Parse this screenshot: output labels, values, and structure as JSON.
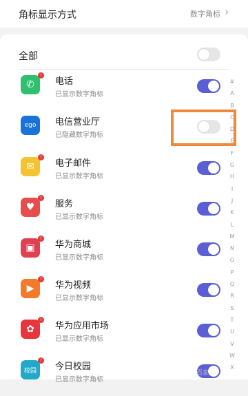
{
  "header": {
    "title": "角标显示方式",
    "value": "数字角标",
    "chevron": "›"
  },
  "all_toggle": {
    "label": "全部",
    "state": "off"
  },
  "apps": [
    {
      "name": "电话",
      "status": "已显示数字角标",
      "icon": "phone-icon",
      "icon_glyph": "✆",
      "icon_color": "#2ec06f",
      "badge": true,
      "toggle": "on"
    },
    {
      "name": "电信营业厅",
      "status": "已隐藏数字角标",
      "icon": "telecom-icon",
      "icon_glyph": "ego",
      "icon_color": "#1a73d8",
      "badge": false,
      "toggle": "off"
    },
    {
      "name": "电子邮件",
      "status": "已显示数字角标",
      "icon": "email-icon",
      "icon_glyph": "✉",
      "icon_color": "#f4c430",
      "badge": true,
      "toggle": "on"
    },
    {
      "name": "服务",
      "status": "已显示数字角标",
      "icon": "service-icon",
      "icon_glyph": "♥",
      "icon_color": "#e84d4d",
      "badge": true,
      "toggle": "on"
    },
    {
      "name": "华为商城",
      "status": "已显示数字角标",
      "icon": "huawei-mall-icon",
      "icon_glyph": "▣",
      "icon_color": "#e04050",
      "badge": true,
      "toggle": "on"
    },
    {
      "name": "华为视频",
      "status": "已显示数字角标",
      "icon": "huawei-video-icon",
      "icon_glyph": "▶",
      "icon_color": "#f47a2a",
      "badge": true,
      "toggle": "on"
    },
    {
      "name": "华为应用市场",
      "status": "已显示数字角标",
      "icon": "huawei-appgallery-icon",
      "icon_glyph": "✿",
      "icon_color": "#e8343a",
      "badge": true,
      "toggle": "on"
    },
    {
      "name": "今日校园",
      "status": "已显示数字角标",
      "icon": "campus-icon",
      "icon_glyph": "校园",
      "icon_color": "#22a8c8",
      "badge": true,
      "toggle": "on"
    }
  ],
  "index_letters": [
    "#",
    "A",
    "B",
    "C",
    "D",
    "E",
    "F",
    "G",
    "H",
    "I",
    "J",
    "K",
    "L",
    "M",
    "N",
    "O",
    "P",
    "Q",
    "R",
    "S",
    "T",
    "U",
    "V",
    "W",
    "X"
  ],
  "watermark": "百家"
}
